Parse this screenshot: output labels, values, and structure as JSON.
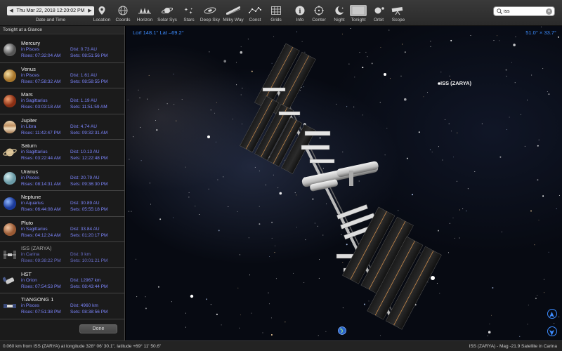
{
  "toolbar": {
    "datetime_value": "Thu Mar 22, 2018  12:20:02 PM",
    "datetime_label": "Date and Time",
    "buttons": [
      {
        "label": "Location",
        "icon": "location-pin-icon"
      },
      {
        "label": "Coords",
        "icon": "coords-globe-icon"
      },
      {
        "label": "Horizon",
        "icon": "horizon-trees-icon"
      },
      {
        "label": "Solar Sys",
        "icon": "saturn-icon"
      },
      {
        "label": "Stars",
        "icon": "stars-icon"
      },
      {
        "label": "Deep Sky",
        "icon": "galaxy-icon"
      },
      {
        "label": "Milky Way",
        "icon": "milky-way-icon"
      },
      {
        "label": "Const",
        "icon": "constellation-icon"
      },
      {
        "label": "Grids",
        "icon": "grid-icon"
      },
      {
        "label": "Info",
        "icon": "info-icon"
      },
      {
        "label": "Center",
        "icon": "crosshair-icon"
      },
      {
        "label": "Night",
        "icon": "moon-icon"
      },
      {
        "label": "Tonight",
        "icon": "tonight-icon"
      },
      {
        "label": "Orbit",
        "icon": "orbit-icon"
      },
      {
        "label": "Scope",
        "icon": "telescope-icon"
      }
    ],
    "active_button": "Tonight",
    "search_value": "iss"
  },
  "sidebar": {
    "header": "Tonight at a Glance",
    "done_label": "Done",
    "objects": [
      {
        "name": "Mercury",
        "constellation": "in Pisces",
        "rises": "Rises: 07:32:04 AM",
        "dist": "Dist: 0.73 AU",
        "sets": "Sets: 08:51:56 PM",
        "thumb": "mercury"
      },
      {
        "name": "Venus",
        "constellation": "in Pisces",
        "rises": "Rises: 07:58:32 AM",
        "dist": "Dist: 1.61 AU",
        "sets": "Sets: 08:58:55 PM",
        "thumb": "venus"
      },
      {
        "name": "Mars",
        "constellation": "in Sagittarius",
        "rises": "Rises: 03:03:18 AM",
        "dist": "Dist: 1.19 AU",
        "sets": "Sets: 11:51:59 AM",
        "thumb": "mars"
      },
      {
        "name": "Jupiter",
        "constellation": "in Libra",
        "rises": "Rises: 11:42:47 PM",
        "dist": "Dist: 4.74 AU",
        "sets": "Sets: 09:32:31 AM",
        "thumb": "jupiter"
      },
      {
        "name": "Saturn",
        "constellation": "in Sagittarius",
        "rises": "Rises: 03:22:44 AM",
        "dist": "Dist: 10.13 AU",
        "sets": "Sets: 12:22:48 PM",
        "thumb": "saturn"
      },
      {
        "name": "Uranus",
        "constellation": "in Pisces",
        "rises": "Rises: 08:14:31 AM",
        "dist": "Dist: 20.79 AU",
        "sets": "Sets: 09:36:30 PM",
        "thumb": "uranus"
      },
      {
        "name": "Neptune",
        "constellation": "in Aquarius",
        "rises": "Rises: 06:44:08 AM",
        "dist": "Dist: 30.89 AU",
        "sets": "Sets: 05:55:18 PM",
        "thumb": "neptune"
      },
      {
        "name": "Pluto",
        "constellation": "in Sagittarius",
        "rises": "Rises: 04:12:24 AM",
        "dist": "Dist: 33.84 AU",
        "sets": "Sets: 01:20:17 PM",
        "thumb": "pluto"
      },
      {
        "name": "ISS (ZARYA)",
        "constellation": "in Carina",
        "rises": "Rises: 09:38:22 PM",
        "dist": "Dist: 0 km",
        "sets": "Sets: 10:01:21 PM",
        "thumb": "iss",
        "dim": true
      },
      {
        "name": "HST",
        "constellation": "in Orion",
        "rises": "Rises: 07:54:53 PM",
        "dist": "Dist: 12967 km",
        "sets": "Sets: 08:43:44 PM",
        "thumb": "hst"
      },
      {
        "name": "TIANGONG 1",
        "constellation": "in Pisces",
        "rises": "Rises: 07:51:38 PM",
        "dist": "Dist: 4960 km",
        "sets": "Sets: 08:38:56 PM",
        "thumb": "tiangong"
      }
    ]
  },
  "sky": {
    "coords_left": "Lon 148.1°  Lat –69.2°",
    "coords_right": "51.0° × 33.7°",
    "object_label": "ISS (ZARYA)"
  },
  "status": {
    "left": "0.060 km from ISS (ZARYA) at longitude 328° 06' 30.1\", latitude +69° 11' 50.6\"",
    "right": "ISS (ZARYA) - Mag -21.9 Satellite in Carina"
  },
  "colors": {
    "accent_blue": "#3d8cff",
    "detail_text": "#7d86ff",
    "toolbar_bg": "#2e2e2e",
    "sidebar_bg": "#1b1b1b"
  }
}
